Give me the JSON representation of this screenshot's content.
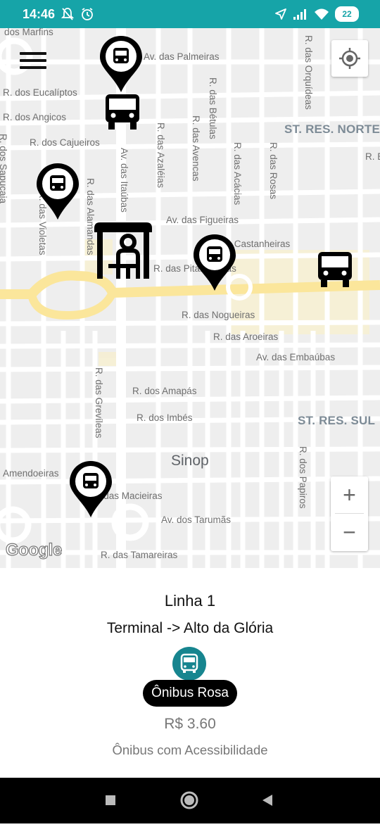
{
  "status_bar": {
    "time": "14:46",
    "battery": "22",
    "icons_left": [
      "notifications-off-icon",
      "alarm-icon"
    ],
    "icons_right": [
      "location-arrow-icon",
      "signal-icon",
      "wifi-icon",
      "battery-icon"
    ]
  },
  "map": {
    "streets": {
      "dos_marfins": "dos Marfins",
      "palmeiras": "Av. das Palmeiras",
      "orquideas": "R. das Orquídeas",
      "eucaliptos": "R. dos Eucalíptos",
      "angicos": "R. dos Angicos",
      "betulas": "R. das Bétulas",
      "cajueiros": "R. dos Cajueiros",
      "azaleias": "R. das Azaléias",
      "avencas": "R. das Avencas",
      "acacias": "R. das Acácias",
      "rosas": "R. das Rosas",
      "itaubas": "Av. das Itaúbas",
      "alamandas": "R. das Alamandas",
      "violetas": "R. das Violetas",
      "figueiras": "Av. das Figueiras",
      "castanheiras": "R. das Castanheiras",
      "pitangueiras": "R. das Pitangueiras",
      "sapucaia": "R. dos Sapucaia",
      "nogueiras": "R. das Nogueiras",
      "aroeiras": "R. das Aroeiras",
      "embaubas": "Av. das Embaúbas",
      "amapas": "R. dos Amapás",
      "imbes": "R. dos Imbés",
      "grevileas": "R. das Grevíleas",
      "papiros": "R. dos Papiros",
      "amendoeiras": "Amendoeiras",
      "macieiras": "R. das Macieiras",
      "tarumas": "Av. dos Tarumãs",
      "tamareiras": "R. das Tamareiras",
      "rua_e": "R. E"
    },
    "districts": {
      "north": "ST. RES. NORTE",
      "south": "ST. RES. SUL"
    },
    "city": "Sinop",
    "logo": "Google",
    "zoom_in_label": "+",
    "zoom_out_label": "−"
  },
  "info": {
    "line_name": "Linha 1",
    "route": "Terminal -> Alto da Glória",
    "bus_name": "Ônibus Rosa",
    "price": "R$ 3.60",
    "accessibility": "Ônibus com Acessibilidade",
    "bus_icon_color": "#17858f"
  },
  "nav": {
    "buttons": [
      "recent-apps-icon",
      "home-icon",
      "back-icon"
    ]
  },
  "colors": {
    "status_bar": "#16a4a8",
    "map_background": "#eeeeee",
    "main_road": "#fbe69b",
    "road": "#ffffff"
  }
}
